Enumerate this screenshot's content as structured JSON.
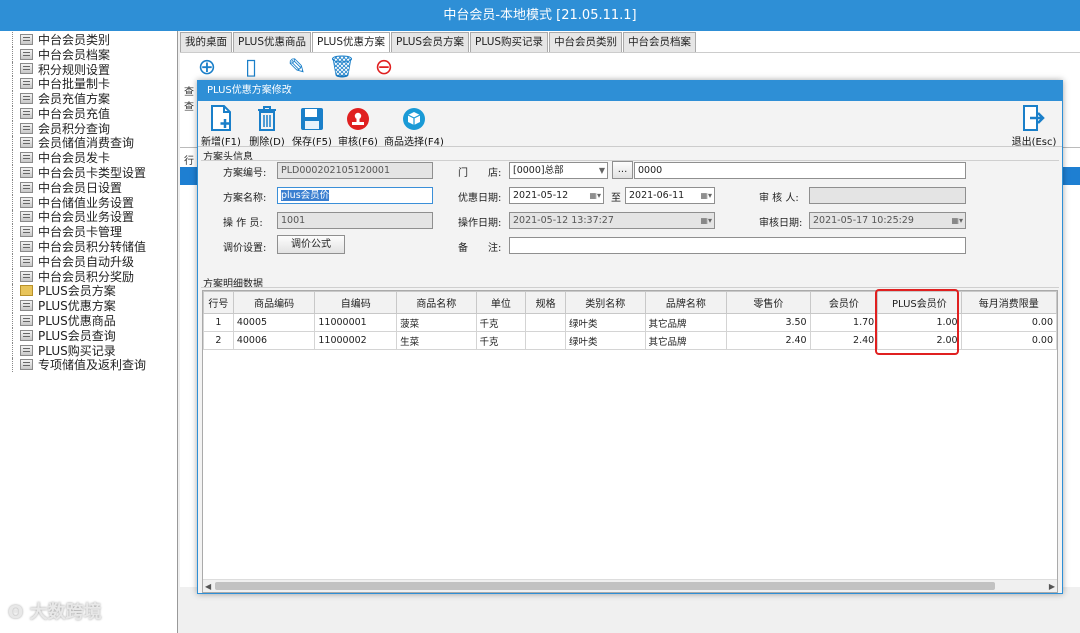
{
  "window": {
    "title": "中台会员-本地模式 [21.05.11.1]"
  },
  "sidebar": {
    "items": [
      {
        "label": "中台会员类别",
        "icon": "doc-icon"
      },
      {
        "label": "中台会员档案",
        "icon": "doc-icon"
      },
      {
        "label": "积分规则设置",
        "icon": "doc-icon"
      },
      {
        "label": "中台批量制卡",
        "icon": "doc-icon"
      },
      {
        "label": "会员充值方案",
        "icon": "doc-icon"
      },
      {
        "label": "中台会员充值",
        "icon": "doc-icon"
      },
      {
        "label": "会员积分查询",
        "icon": "doc-icon"
      },
      {
        "label": "会员储值消费查询",
        "icon": "doc-icon"
      },
      {
        "label": "中台会员发卡",
        "icon": "doc-icon"
      },
      {
        "label": "中台会员卡类型设置",
        "icon": "doc-icon"
      },
      {
        "label": "中台会员日设置",
        "icon": "doc-icon"
      },
      {
        "label": "中台储值业务设置",
        "icon": "doc-icon"
      },
      {
        "label": "中台会员业务设置",
        "icon": "doc-icon"
      },
      {
        "label": "中台会员卡管理",
        "icon": "doc-icon"
      },
      {
        "label": "中台会员积分转储值",
        "icon": "doc-icon"
      },
      {
        "label": "中台会员自动升级",
        "icon": "doc-icon"
      },
      {
        "label": "中台会员积分奖励",
        "icon": "doc-icon"
      },
      {
        "label": "PLUS会员方案",
        "icon": "folder-icon"
      },
      {
        "label": "PLUS优惠方案",
        "icon": "doc-icon"
      },
      {
        "label": "PLUS优惠商品",
        "icon": "doc-icon"
      },
      {
        "label": "PLUS会员查询",
        "icon": "doc-icon"
      },
      {
        "label": "PLUS购买记录",
        "icon": "doc-icon"
      },
      {
        "label": "专项储值及返利查询",
        "icon": "doc-icon"
      }
    ]
  },
  "tabs": [
    {
      "label": "我的桌面",
      "active": false
    },
    {
      "label": "PLUS优惠商品",
      "active": false
    },
    {
      "label": "PLUS优惠方案",
      "active": true
    },
    {
      "label": "PLUS会员方案",
      "active": false
    },
    {
      "label": "PLUS购买记录",
      "active": false
    },
    {
      "label": "中台会员类别",
      "active": false
    },
    {
      "label": "中台会员档案",
      "active": false
    }
  ],
  "background": {
    "row_stub_1": "查",
    "row_stub_2": "查",
    "grid_stub": "行"
  },
  "dialog": {
    "title": "PLUS优惠方案修改",
    "toolbar": {
      "new": "新增(F1)",
      "delete": "删除(D)",
      "save": "保存(F5)",
      "audit": "审核(F6)",
      "select_goods": "商品选择(F4)",
      "exit": "退出(Esc)"
    },
    "header_section": "方案头信息",
    "fields": {
      "plan_no_label": "方案编号:",
      "plan_no": "PLD000202105120001",
      "store_label": "门　　店:",
      "store_value": "[0000]总部",
      "store_browse": "...",
      "store_code": "0000",
      "plan_name_label": "方案名称:",
      "plan_name": "plus会员价",
      "discount_date_label": "优惠日期:",
      "date_from": "2021-05-12",
      "to_label": "至",
      "date_to": "2021-06-11",
      "auditor_label": "审 核 人:",
      "auditor": "",
      "operator_label": "操 作 员:",
      "operator": "1001",
      "op_date_label": "操作日期:",
      "op_date": "2021-05-12 13:37:27",
      "audit_date_label": "审核日期:",
      "audit_date": "2021-05-17 10:25:29",
      "price_setting_label": "调价设置:",
      "price_formula_button": "调价公式",
      "remark_label": "备　　注:",
      "remark": ""
    },
    "detail_section": "方案明细数据",
    "table": {
      "columns": [
        "行号",
        "商品编码",
        "自编码",
        "商品名称",
        "单位",
        "规格",
        "类别名称",
        "品牌名称",
        "零售价",
        "会员价",
        "PLUS会员价",
        "每月消费限量"
      ],
      "rows": [
        [
          "1",
          "40005",
          "11000001",
          "菠菜",
          "千克",
          "",
          "绿叶类",
          "其它品牌",
          "3.50",
          "1.70",
          "1.00",
          "0.00"
        ],
        [
          "2",
          "40006",
          "11000002",
          "生菜",
          "千克",
          "",
          "绿叶类",
          "其它品牌",
          "2.40",
          "2.40",
          "2.00",
          "0.00"
        ]
      ]
    }
  },
  "watermark": "大数跨境",
  "colors": {
    "title_bar": "#2e8fd6",
    "selection": "#1e7fd2",
    "highlight_box": "#e02020"
  }
}
